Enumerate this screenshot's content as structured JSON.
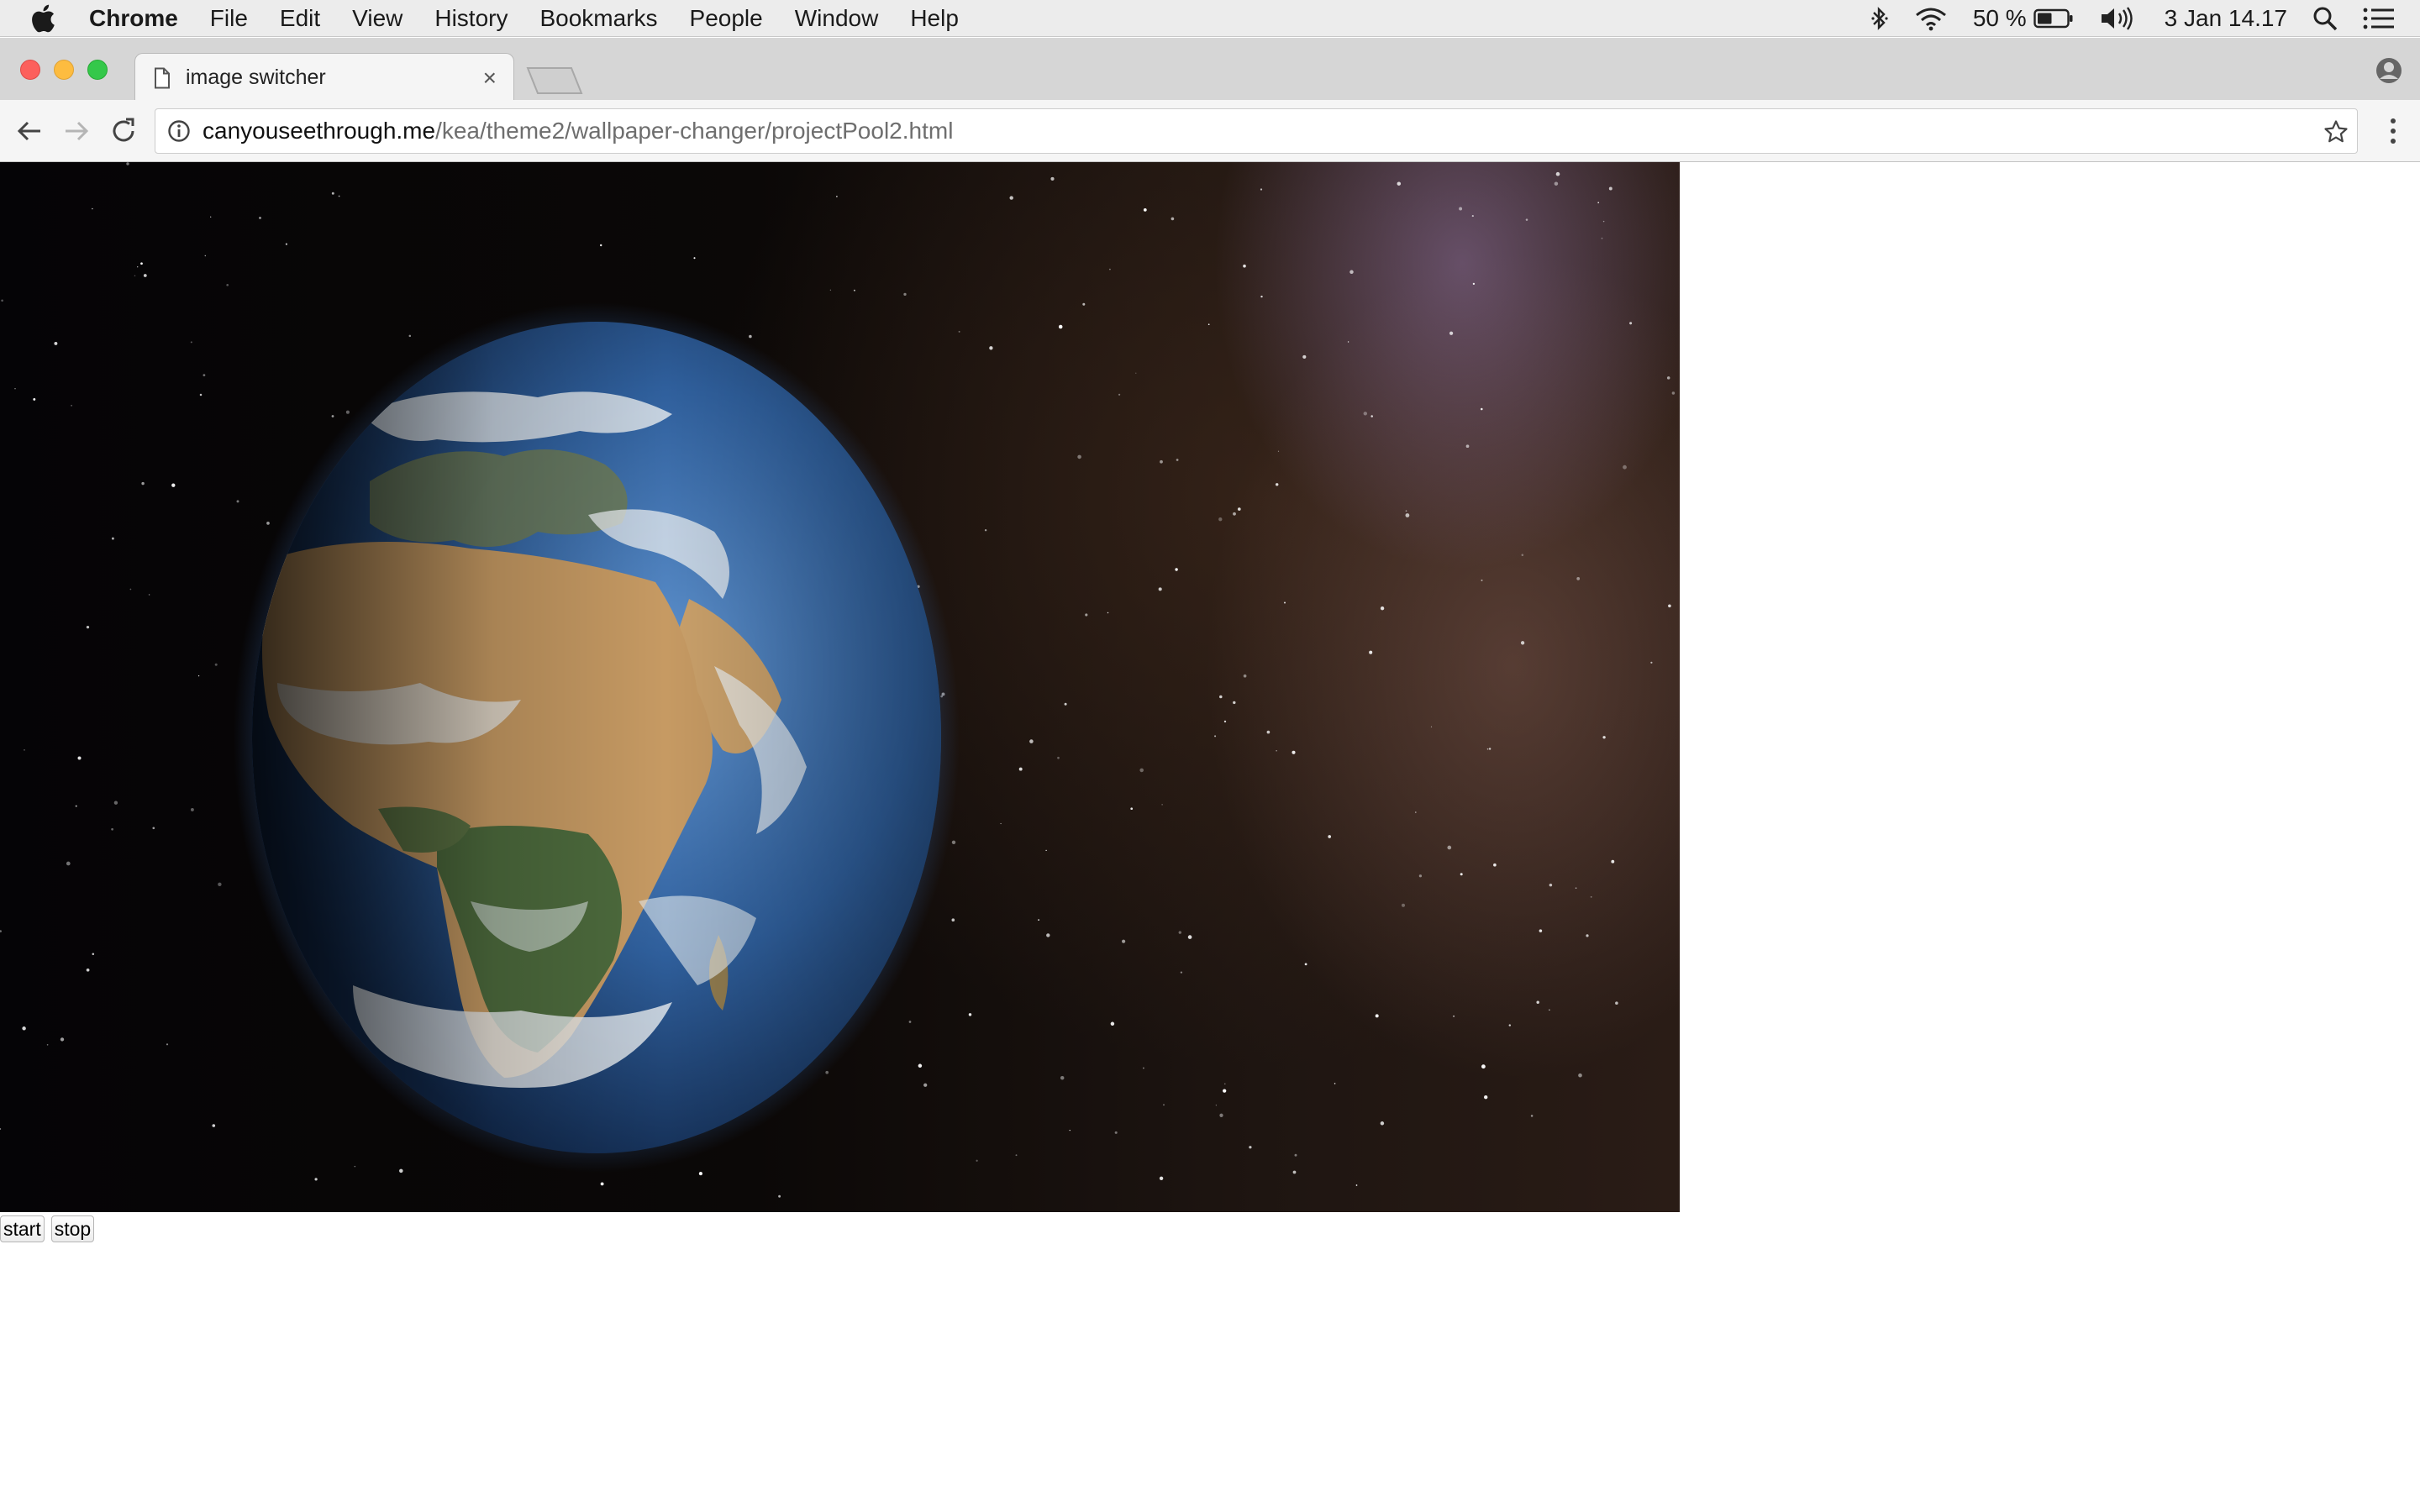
{
  "menubar": {
    "app_name": "Chrome",
    "items": [
      "File",
      "Edit",
      "View",
      "History",
      "Bookmarks",
      "People",
      "Window",
      "Help"
    ],
    "battery_percent": "50 %",
    "battery_level": 0.5,
    "clock": "3 Jan  14.17"
  },
  "tab": {
    "title": "image switcher",
    "close_glyph": "×"
  },
  "toolbar": {
    "url_host": "canyouseethrough.me",
    "url_path": "/kea/theme2/wallpaper-changer/projectPool2.html"
  },
  "page": {
    "start_label": "start",
    "stop_label": "stop"
  },
  "colors": {
    "space": "#070507",
    "ocean": "#2f5f9c",
    "desert": "#c69a63",
    "land_green": "#4d6b3d",
    "cloud": "#e8ecef"
  },
  "icons": [
    "apple-icon",
    "bluetooth-icon",
    "wifi-icon",
    "battery-icon",
    "volume-icon",
    "spotlight-icon",
    "notification-center-icon",
    "document-icon",
    "profile-icon",
    "back-icon",
    "forward-icon",
    "reload-icon",
    "info-icon",
    "star-icon",
    "menu-icon"
  ]
}
